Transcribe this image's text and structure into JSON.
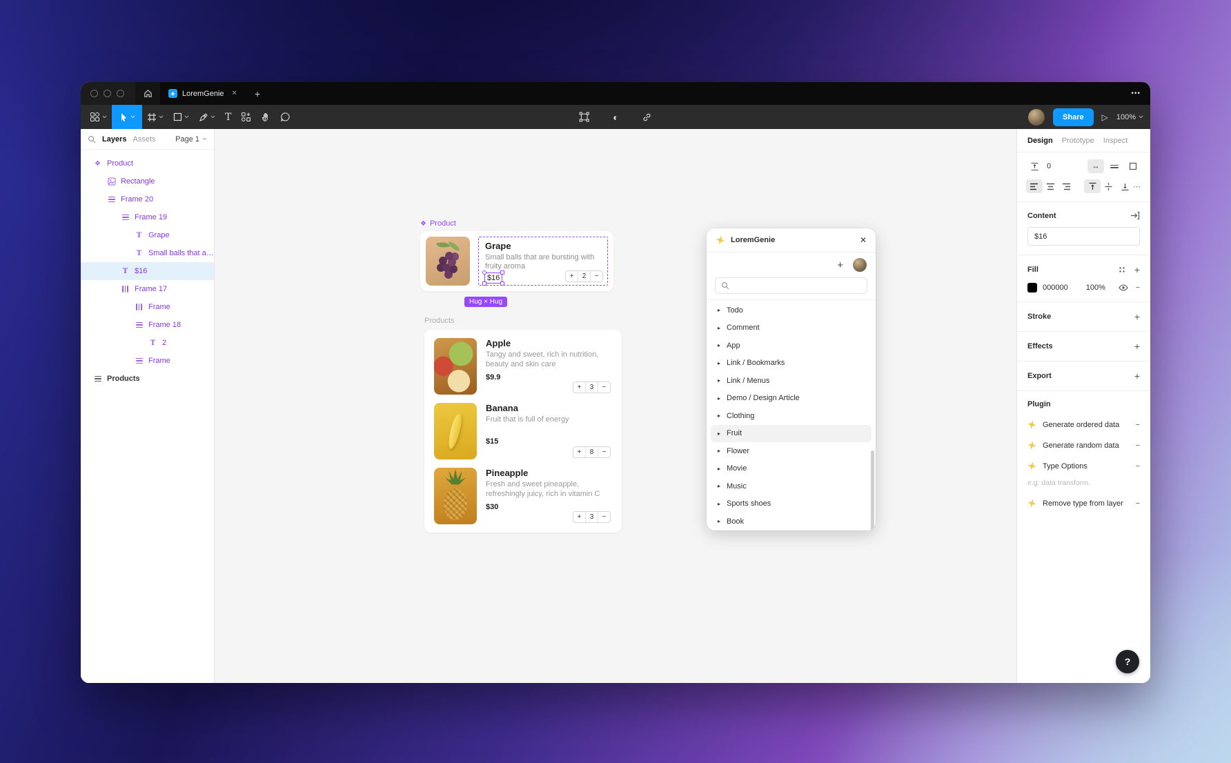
{
  "colors": {
    "accent_blue": "#0D99FF",
    "component_purple": "#8638E5",
    "badge_purple": "#9747FF",
    "selected_row_bg": "#E3F1FC",
    "plugin_star_yellow": "#F2C94C",
    "fill_swatch": "#000000"
  },
  "icons": {
    "close": "✕",
    "plus": "+",
    "minus": "−",
    "more": "•••",
    "contrast": "◐",
    "play": "▷",
    "caret_right": "▸",
    "component_diamond": "❖",
    "arrow_leftright": "↔",
    "ellipsis": "⋯",
    "question": "?",
    "text_glyph": "T"
  },
  "tabbar": {
    "tab_title": "LoremGenie"
  },
  "toolbar": {
    "share_label": "Share",
    "zoom_level": "100%"
  },
  "sidebar": {
    "tabs": {
      "layers": "Layers",
      "assets": "Assets",
      "page": "Page 1"
    },
    "layers": [
      {
        "label": "Product",
        "icon": "component",
        "level": 0
      },
      {
        "label": "Rectangle",
        "icon": "image",
        "level": 1
      },
      {
        "label": "Frame 20",
        "icon": "layout-v",
        "level": 1
      },
      {
        "label": "Frame 19",
        "icon": "layout-v",
        "level": 2
      },
      {
        "label": "Grape",
        "icon": "text",
        "level": 3
      },
      {
        "label": "Small balls that are ...",
        "icon": "text",
        "level": 3
      },
      {
        "label": "$16",
        "icon": "text",
        "level": 2,
        "state": "selected"
      },
      {
        "label": "Frame 17",
        "icon": "layout-h",
        "level": 2
      },
      {
        "label": "Frame",
        "icon": "layout-h",
        "level": 3
      },
      {
        "label": "Frame 18",
        "icon": "layout-v",
        "level": 3
      },
      {
        "label": "2",
        "icon": "text",
        "level": 4
      },
      {
        "label": "Frame",
        "icon": "layout-v",
        "level": 3
      },
      {
        "label": "Products",
        "icon": "layout-v",
        "level": 0
      }
    ]
  },
  "canvas": {
    "component_label": "Product",
    "grape": {
      "title": "Grape",
      "description": "Small balls that are bursting with fruity aroma",
      "price": "$16",
      "qty": "2",
      "size_badge": "Hug × Hug"
    },
    "products_label": "Products",
    "products": [
      {
        "name": "Apple",
        "description": "Tangy and sweet, rich in nutrition, beauty and skin care",
        "price": "$9.9",
        "qty": "3"
      },
      {
        "name": "Banana",
        "description": "Fruit that is full of energy",
        "price": "$15",
        "qty": "8"
      },
      {
        "name": "Pineapple",
        "description": "Fresh and sweet pineapple, refreshingly juicy, rich in vitamin C",
        "price": "$30",
        "qty": "3"
      }
    ]
  },
  "plugin_dialog": {
    "title": "LoremGenie",
    "highlighted": "Fruit",
    "categories": [
      "Todo",
      "Comment",
      "App",
      "Link / Bookmarks",
      "Link / Menus",
      "Demo / Design Article",
      "Clothing",
      "Fruit",
      "Flower",
      "Movie",
      "Music",
      "Sports shoes",
      "Book"
    ]
  },
  "inspector": {
    "tabs": {
      "design": "Design",
      "prototype": "Prototype",
      "inspect": "Inspect"
    },
    "spacing_value": "0",
    "content": {
      "label": "Content",
      "value": "$16"
    },
    "fill": {
      "label": "Fill",
      "hex": "000000",
      "opacity": "100%"
    },
    "stroke": {
      "label": "Stroke"
    },
    "effects": {
      "label": "Effects"
    },
    "export": {
      "label": "Export"
    },
    "plugin": {
      "label": "Plugin",
      "actions": [
        "Generate ordered data",
        "Generate random data",
        "Type Options",
        "Remove type from layer"
      ],
      "type_options_placeholder": "e.g: data transform."
    }
  }
}
